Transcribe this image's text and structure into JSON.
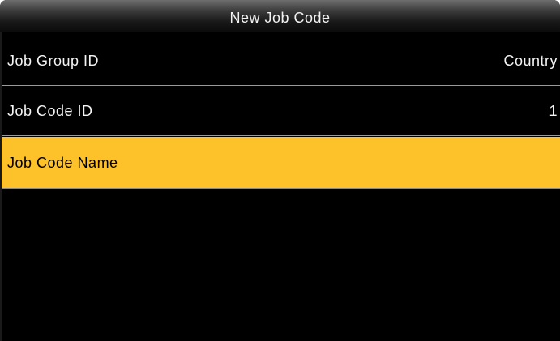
{
  "header": {
    "title": "New Job Code"
  },
  "menu": {
    "items": [
      {
        "label": "Job Group ID",
        "value": "Country"
      },
      {
        "label": "Job Code ID",
        "value": "1"
      },
      {
        "label": "Job Code Name",
        "value": "",
        "selected": true
      }
    ]
  },
  "colors": {
    "background": "#000000",
    "highlight": "#fdc12a",
    "text": "#f4f4f4",
    "selected_text": "#000000"
  }
}
